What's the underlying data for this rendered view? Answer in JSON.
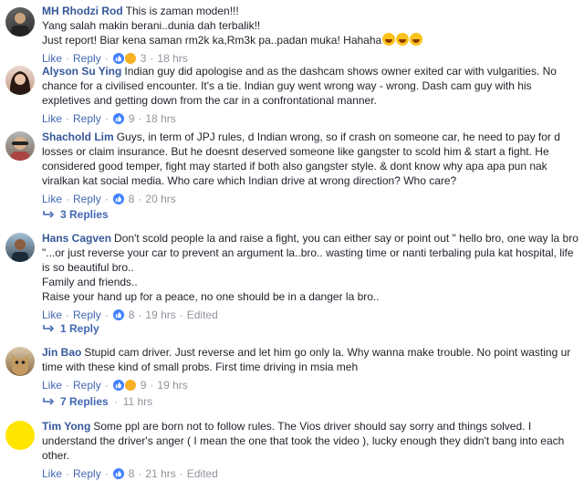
{
  "comments": [
    {
      "name": "MH Rhodzi Rod",
      "text": "This is zaman moden!!!\nYang salah makin berani..dunia dah terbalik!!\nJust report! Biar kena saman rm2k ka,Rm3k pa..padan muka! Hahaha",
      "like": "Like",
      "reply": "Reply",
      "reactions": "3",
      "time": "18 hrs",
      "edited": ""
    },
    {
      "name": "Alyson Su Ying",
      "text": "Indian guy did apologise and as the dashcam shows owner exited car with vulgarities. No chance for a civilised encounter. It's a tie. Indian guy went wrong way - wrong. Dash cam guy with his expletives and getting down from the car in a confrontational manner.",
      "like": "Like",
      "reply": "Reply",
      "reactions": "9",
      "time": "18 hrs",
      "edited": ""
    },
    {
      "name": "Shachold Lim",
      "text": "Guys, in term of JPJ rules, d Indian wrong, so if crash on someone car, he need to pay for d losses or claim insurance. But he doesnt deserved someone like gangster to scold him & start a fight. He considered good temper, fight may started if both also gangster style. & dont know why apa apa pun nak viralkan kat social media. Who care which Indian drive at wrong direction? Who care?",
      "like": "Like",
      "reply": "Reply",
      "reactions": "8",
      "time": "20 hrs",
      "edited": ""
    },
    {
      "name": "Hans Cagven",
      "text": "Don't scold people la and raise a fight, you can either say or point out \" hello bro, one way la bro \"...or just reverse your car to prevent an argument la..bro.. wasting time or nanti terbaling pula kat hospital, life is so beautiful bro..\nFamily and friends..\nRaise your hand up for a peace, no one should be in a danger la bro..",
      "like": "Like",
      "reply": "Reply",
      "reactions": "8",
      "time": "19 hrs",
      "edited": "Edited"
    },
    {
      "name": "Jin Bao",
      "text": "Stupid cam driver. Just reverse and let him go only la. Why wanna make trouble. No point wasting ur time with these kind of small probs. First time driving in msia meh",
      "like": "Like",
      "reply": "Reply",
      "reactions": "9",
      "time": "19 hrs",
      "edited": ""
    },
    {
      "name": "Tim Yong",
      "text": "Some ppl are born not to follow rules. The Vios driver should say sorry and things solved. I understand the driver's anger ( I mean the one that took the video ), lucky enough they didn't bang into each other.",
      "like": "Like",
      "reply": "Reply",
      "reactions": "8",
      "time": "21 hrs",
      "edited": "Edited"
    }
  ],
  "reply_threads": [
    {
      "label": "3 Replies",
      "time": ""
    },
    {
      "label": "1 Reply",
      "time": ""
    },
    {
      "label": "7 Replies",
      "time": "11 hrs"
    }
  ],
  "separator": "·",
  "colors": {
    "link": "#4267b2",
    "name": "#365899",
    "meta": "#90949c",
    "like": "#4080ff"
  }
}
